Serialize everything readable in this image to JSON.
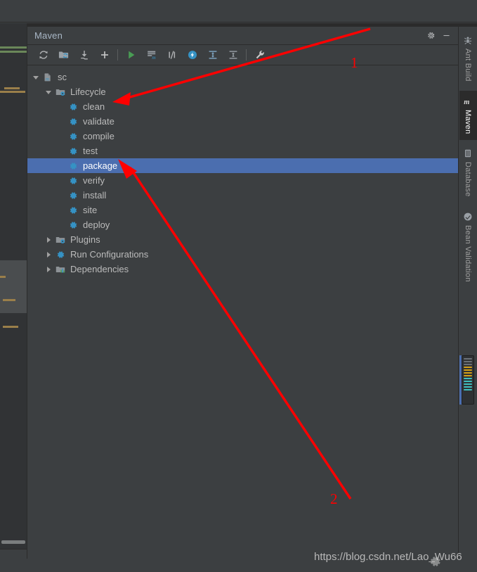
{
  "window": {
    "background_color": "#3c3f41",
    "editor_background": "#2b2b2b"
  },
  "maven_panel": {
    "title": "Maven",
    "header_buttons": [
      {
        "name": "settings-gear-button",
        "icon": "gear-icon",
        "label": "Settings"
      },
      {
        "name": "hide-button",
        "icon": "minimize-icon",
        "label": "Hide"
      }
    ],
    "toolbar": [
      {
        "name": "reimport-button",
        "icon": "refresh-icon",
        "label": "Reimport All Maven Projects"
      },
      {
        "name": "generate-sources-button",
        "icon": "folder-refresh-icon",
        "label": "Generate Sources and Update Folders"
      },
      {
        "name": "download-sources-button",
        "icon": "download-icon",
        "label": "Download Sources and/or Documentation"
      },
      {
        "name": "add-maven-project-button",
        "icon": "plus-icon",
        "label": "Add Maven Projects"
      },
      {
        "name": "run-button",
        "icon": "run-triangle-icon",
        "label": "Run Maven Build"
      },
      {
        "name": "execute-goal-button",
        "icon": "execute-goal-icon",
        "label": "Execute Maven Goal"
      },
      {
        "name": "toggle-skip-tests-button",
        "icon": "skip-tests-icon",
        "label": "Toggle Skip Tests Mode"
      },
      {
        "name": "toggle-offline-button",
        "icon": "offline-bolt-icon",
        "label": "Toggle Offline Mode"
      },
      {
        "name": "expand-all-button",
        "icon": "expand-all-icon",
        "label": "Expand All"
      },
      {
        "name": "collapse-all-button",
        "icon": "collapse-all-icon",
        "label": "Collapse All"
      },
      {
        "name": "maven-settings-button",
        "icon": "wrench-icon",
        "label": "Maven Settings"
      }
    ],
    "tree": [
      {
        "name": "tree-node-sc",
        "label": "sc",
        "indent": 0,
        "twisty": "down",
        "icon": "maven-module-icon",
        "selected": false
      },
      {
        "name": "tree-node-lifecycle",
        "label": "Lifecycle",
        "indent": 1,
        "twisty": "down",
        "icon": "folder-gear-icon",
        "selected": false
      },
      {
        "name": "tree-node-clean",
        "label": "clean",
        "indent": 2,
        "twisty": "none",
        "icon": "gear-blue-icon",
        "selected": false
      },
      {
        "name": "tree-node-validate",
        "label": "validate",
        "indent": 2,
        "twisty": "none",
        "icon": "gear-blue-icon",
        "selected": false
      },
      {
        "name": "tree-node-compile",
        "label": "compile",
        "indent": 2,
        "twisty": "none",
        "icon": "gear-blue-icon",
        "selected": false
      },
      {
        "name": "tree-node-test",
        "label": "test",
        "indent": 2,
        "twisty": "none",
        "icon": "gear-blue-icon",
        "selected": false
      },
      {
        "name": "tree-node-package",
        "label": "package",
        "indent": 2,
        "twisty": "none",
        "icon": "gear-blue-icon",
        "selected": true
      },
      {
        "name": "tree-node-verify",
        "label": "verify",
        "indent": 2,
        "twisty": "none",
        "icon": "gear-blue-icon",
        "selected": false
      },
      {
        "name": "tree-node-install",
        "label": "install",
        "indent": 2,
        "twisty": "none",
        "icon": "gear-blue-icon",
        "selected": false
      },
      {
        "name": "tree-node-site",
        "label": "site",
        "indent": 2,
        "twisty": "none",
        "icon": "gear-blue-icon",
        "selected": false
      },
      {
        "name": "tree-node-deploy",
        "label": "deploy",
        "indent": 2,
        "twisty": "none",
        "icon": "gear-blue-icon",
        "selected": false
      },
      {
        "name": "tree-node-plugins",
        "label": "Plugins",
        "indent": 1,
        "twisty": "right",
        "icon": "folder-gear-icon",
        "selected": false
      },
      {
        "name": "tree-node-run-configurations",
        "label": "Run Configurations",
        "indent": 1,
        "twisty": "right",
        "icon": "gear-blue-icon",
        "selected": false
      },
      {
        "name": "tree-node-dependencies",
        "label": "Dependencies",
        "indent": 1,
        "twisty": "right",
        "icon": "dependencies-icon",
        "selected": false
      }
    ],
    "selection_color": "#4b6eaf"
  },
  "tool_stripe": [
    {
      "name": "stripe-button-ant-build",
      "label": "Ant Build",
      "icon": "ant-icon",
      "active": false
    },
    {
      "name": "stripe-button-maven",
      "label": "Maven",
      "icon": "maven-m-icon",
      "active": true
    },
    {
      "name": "stripe-button-database",
      "label": "Database",
      "icon": "database-icon",
      "active": false
    },
    {
      "name": "stripe-button-bean-validation",
      "label": "Bean Validation",
      "icon": "bean-validation-icon",
      "active": false
    }
  ],
  "annotations": {
    "color": "#ff0000",
    "markers": [
      {
        "name": "annotation-number-1",
        "label": "1",
        "points_to": "tree-node-clean"
      },
      {
        "name": "annotation-number-2",
        "label": "2",
        "points_to": "tree-node-package"
      }
    ]
  },
  "watermark": {
    "text": "https://blog.csdn.net/Lao_Wu66"
  }
}
